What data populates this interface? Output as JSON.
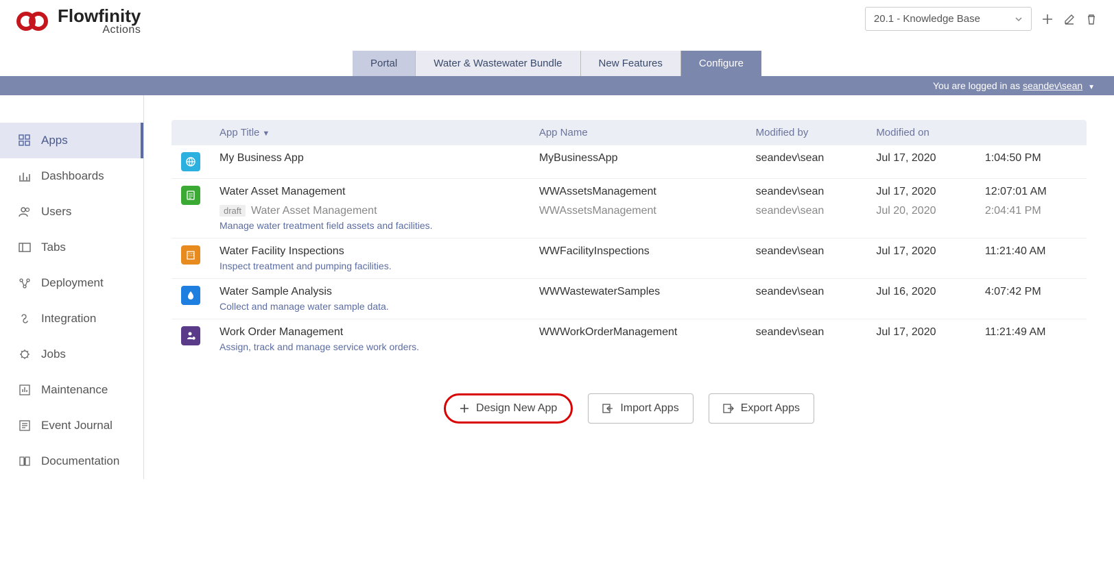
{
  "brand": {
    "name": "Flowfinity",
    "sub": "Actions"
  },
  "dropdown": {
    "label": "20.1 - Knowledge Base"
  },
  "tabs": [
    "Portal",
    "Water & Wastewater Bundle",
    "New Features",
    "Configure"
  ],
  "login": {
    "prefix": "You are logged in as ",
    "user": "seandev\\sean"
  },
  "sidebar": [
    {
      "label": "Apps"
    },
    {
      "label": "Dashboards"
    },
    {
      "label": "Users"
    },
    {
      "label": "Tabs"
    },
    {
      "label": "Deployment"
    },
    {
      "label": "Integration"
    },
    {
      "label": "Jobs"
    },
    {
      "label": "Maintenance"
    },
    {
      "label": "Event Journal"
    },
    {
      "label": "Documentation"
    }
  ],
  "columns": {
    "title": "App Title",
    "name": "App Name",
    "modby": "Modified by",
    "modon": "Modified on"
  },
  "rows": [
    {
      "icon_color": "#2bb0e0",
      "title": "My Business App",
      "name": "MyBusinessApp",
      "modby": "seandev\\sean",
      "date": "Jul 17, 2020",
      "time": "1:04:50 PM"
    },
    {
      "icon_color": "#3aaa35",
      "title": "Water Asset Management",
      "name": "WWAssetsManagement",
      "modby": "seandev\\sean",
      "date": "Jul 17, 2020",
      "time": "12:07:01 AM",
      "draft": {
        "badge": "draft",
        "title": "Water Asset Management",
        "name": "WWAssetsManagement",
        "modby": "seandev\\sean",
        "date": "Jul 20, 2020",
        "time": "2:04:41 PM"
      },
      "desc": "Manage water treatment field assets and facilities."
    },
    {
      "icon_color": "#e78b1e",
      "title": "Water Facility Inspections",
      "desc": "Inspect treatment and pumping facilities.",
      "name": "WWFacilityInspections",
      "modby": "seandev\\sean",
      "date": "Jul 17, 2020",
      "time": "11:21:40 AM"
    },
    {
      "icon_color": "#1e7fe0",
      "title": "Water Sample Analysis",
      "desc": "Collect and manage water sample data.",
      "name": "WWWastewaterSamples",
      "modby": "seandev\\sean",
      "date": "Jul 16, 2020",
      "time": "4:07:42 PM"
    },
    {
      "icon_color": "#5a3b8a",
      "title": "Work Order Management",
      "desc": "Assign, track and manage service work orders.",
      "name": "WWWorkOrderManagement",
      "modby": "seandev\\sean",
      "date": "Jul 17, 2020",
      "time": "11:21:49 AM"
    }
  ],
  "buttons": {
    "design": "Design New App",
    "import": "Import Apps",
    "export": "Export Apps"
  }
}
